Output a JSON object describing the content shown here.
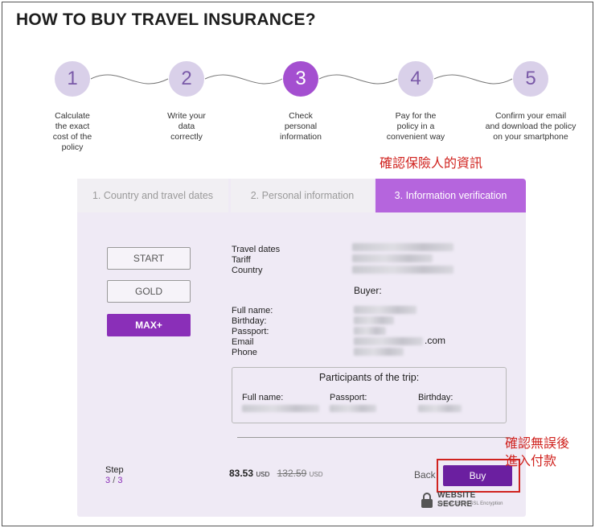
{
  "title": "HOW TO BUY TRAVEL INSURANCE?",
  "steps": [
    {
      "number": "1",
      "text": [
        "Calculate",
        "the exact",
        "cost of the",
        "policy"
      ]
    },
    {
      "number": "2",
      "text": [
        "Write your",
        "data",
        "correctly"
      ]
    },
    {
      "number": "3",
      "text": [
        "Check",
        "personal",
        "information"
      ]
    },
    {
      "number": "4",
      "text": [
        "Pay for the",
        "policy in a",
        "convenient way"
      ]
    },
    {
      "number": "5",
      "text": [
        "Confirm your email",
        "and download the policy",
        "on your smartphone"
      ]
    }
  ],
  "annotations": {
    "verify_note": "確認保險人的資訊",
    "confirm_note_line1": "確認無誤後",
    "confirm_note_line2": "進入付款"
  },
  "tabs": {
    "tab1": "1. Country and travel dates",
    "tab2": "2. Personal information",
    "tab3": "3. Information verification"
  },
  "plans": {
    "start": "START",
    "gold": "GOLD",
    "max": "MAX+"
  },
  "trip_labels": {
    "travel_dates": "Travel dates",
    "tariff": "Tariff",
    "country": "Country"
  },
  "buyer": {
    "heading": "Buyer:",
    "full_name": "Full name:",
    "birthday": "Birthday:",
    "passport": "Passport:",
    "email": "Email",
    "phone": "Phone",
    "email_suffix": ".com"
  },
  "participants": {
    "heading": "Participants of the trip:",
    "full_name": "Full name:",
    "passport": "Passport:",
    "birthday": "Birthday:"
  },
  "footer": {
    "step_label": "Step",
    "step_current": "3",
    "step_sep": "/",
    "step_total": "3",
    "price": "83.53",
    "price_currency": "USD",
    "old_price": "132.59",
    "old_price_currency": "USD",
    "back_label": "Back",
    "buy_label": "Buy",
    "secure_title": "WEBSITE SECURE",
    "secure_sub": "Secure 256 bit SSL Encryption"
  },
  "colors": {
    "accent": "#a44fd0",
    "buy": "#6b1fa0",
    "annotation": "#d0231f"
  }
}
